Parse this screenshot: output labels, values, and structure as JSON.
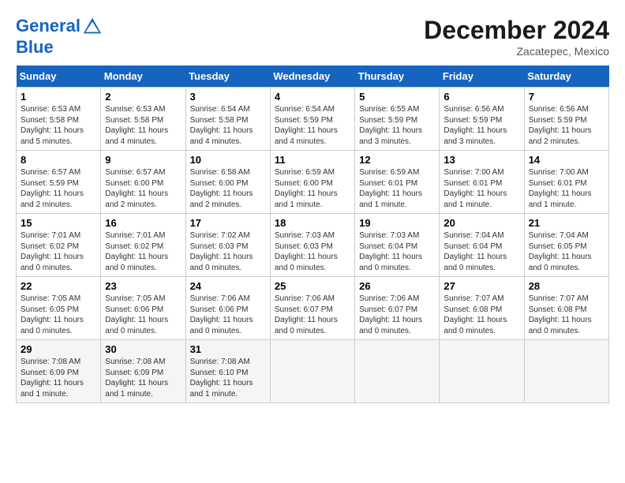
{
  "header": {
    "logo_line1": "General",
    "logo_line2": "Blue",
    "month_title": "December 2024",
    "location": "Zacatepec, Mexico"
  },
  "weekdays": [
    "Sunday",
    "Monday",
    "Tuesday",
    "Wednesday",
    "Thursday",
    "Friday",
    "Saturday"
  ],
  "weeks": [
    [
      {
        "day": "1",
        "info": "Sunrise: 6:53 AM\nSunset: 5:58 PM\nDaylight: 11 hours and 5 minutes."
      },
      {
        "day": "2",
        "info": "Sunrise: 6:53 AM\nSunset: 5:58 PM\nDaylight: 11 hours and 4 minutes."
      },
      {
        "day": "3",
        "info": "Sunrise: 6:54 AM\nSunset: 5:58 PM\nDaylight: 11 hours and 4 minutes."
      },
      {
        "day": "4",
        "info": "Sunrise: 6:54 AM\nSunset: 5:59 PM\nDaylight: 11 hours and 4 minutes."
      },
      {
        "day": "5",
        "info": "Sunrise: 6:55 AM\nSunset: 5:59 PM\nDaylight: 11 hours and 3 minutes."
      },
      {
        "day": "6",
        "info": "Sunrise: 6:56 AM\nSunset: 5:59 PM\nDaylight: 11 hours and 3 minutes."
      },
      {
        "day": "7",
        "info": "Sunrise: 6:56 AM\nSunset: 5:59 PM\nDaylight: 11 hours and 2 minutes."
      }
    ],
    [
      {
        "day": "8",
        "info": "Sunrise: 6:57 AM\nSunset: 5:59 PM\nDaylight: 11 hours and 2 minutes."
      },
      {
        "day": "9",
        "info": "Sunrise: 6:57 AM\nSunset: 6:00 PM\nDaylight: 11 hours and 2 minutes."
      },
      {
        "day": "10",
        "info": "Sunrise: 6:58 AM\nSunset: 6:00 PM\nDaylight: 11 hours and 2 minutes."
      },
      {
        "day": "11",
        "info": "Sunrise: 6:59 AM\nSunset: 6:00 PM\nDaylight: 11 hours and 1 minute."
      },
      {
        "day": "12",
        "info": "Sunrise: 6:59 AM\nSunset: 6:01 PM\nDaylight: 11 hours and 1 minute."
      },
      {
        "day": "13",
        "info": "Sunrise: 7:00 AM\nSunset: 6:01 PM\nDaylight: 11 hours and 1 minute."
      },
      {
        "day": "14",
        "info": "Sunrise: 7:00 AM\nSunset: 6:01 PM\nDaylight: 11 hours and 1 minute."
      }
    ],
    [
      {
        "day": "15",
        "info": "Sunrise: 7:01 AM\nSunset: 6:02 PM\nDaylight: 11 hours and 0 minutes."
      },
      {
        "day": "16",
        "info": "Sunrise: 7:01 AM\nSunset: 6:02 PM\nDaylight: 11 hours and 0 minutes."
      },
      {
        "day": "17",
        "info": "Sunrise: 7:02 AM\nSunset: 6:03 PM\nDaylight: 11 hours and 0 minutes."
      },
      {
        "day": "18",
        "info": "Sunrise: 7:03 AM\nSunset: 6:03 PM\nDaylight: 11 hours and 0 minutes."
      },
      {
        "day": "19",
        "info": "Sunrise: 7:03 AM\nSunset: 6:04 PM\nDaylight: 11 hours and 0 minutes."
      },
      {
        "day": "20",
        "info": "Sunrise: 7:04 AM\nSunset: 6:04 PM\nDaylight: 11 hours and 0 minutes."
      },
      {
        "day": "21",
        "info": "Sunrise: 7:04 AM\nSunset: 6:05 PM\nDaylight: 11 hours and 0 minutes."
      }
    ],
    [
      {
        "day": "22",
        "info": "Sunrise: 7:05 AM\nSunset: 6:05 PM\nDaylight: 11 hours and 0 minutes."
      },
      {
        "day": "23",
        "info": "Sunrise: 7:05 AM\nSunset: 6:06 PM\nDaylight: 11 hours and 0 minutes."
      },
      {
        "day": "24",
        "info": "Sunrise: 7:06 AM\nSunset: 6:06 PM\nDaylight: 11 hours and 0 minutes."
      },
      {
        "day": "25",
        "info": "Sunrise: 7:06 AM\nSunset: 6:07 PM\nDaylight: 11 hours and 0 minutes."
      },
      {
        "day": "26",
        "info": "Sunrise: 7:06 AM\nSunset: 6:07 PM\nDaylight: 11 hours and 0 minutes."
      },
      {
        "day": "27",
        "info": "Sunrise: 7:07 AM\nSunset: 6:08 PM\nDaylight: 11 hours and 0 minutes."
      },
      {
        "day": "28",
        "info": "Sunrise: 7:07 AM\nSunset: 6:08 PM\nDaylight: 11 hours and 0 minutes."
      }
    ],
    [
      {
        "day": "29",
        "info": "Sunrise: 7:08 AM\nSunset: 6:09 PM\nDaylight: 11 hours and 1 minute."
      },
      {
        "day": "30",
        "info": "Sunrise: 7:08 AM\nSunset: 6:09 PM\nDaylight: 11 hours and 1 minute."
      },
      {
        "day": "31",
        "info": "Sunrise: 7:08 AM\nSunset: 6:10 PM\nDaylight: 11 hours and 1 minute."
      },
      {
        "day": "",
        "info": ""
      },
      {
        "day": "",
        "info": ""
      },
      {
        "day": "",
        "info": ""
      },
      {
        "day": "",
        "info": ""
      }
    ]
  ]
}
